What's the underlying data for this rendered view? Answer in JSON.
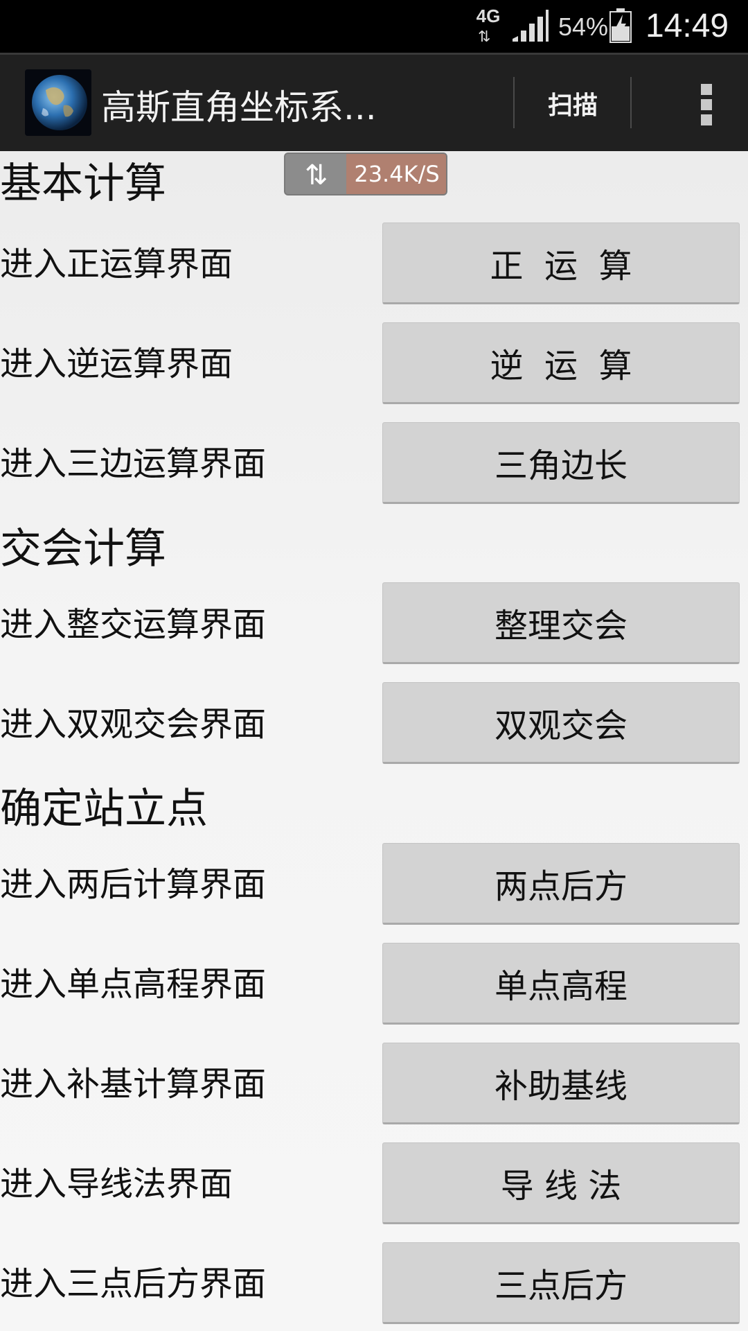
{
  "status_bar": {
    "network": "4G",
    "battery": "54%",
    "time": "14:49"
  },
  "action_bar": {
    "title": "高斯直角坐标系...",
    "scan_label": "扫描",
    "app_icon": "globe-icon",
    "overflow_icon": "overflow-menu-icon"
  },
  "speed_indicator": {
    "icon": "sync-arrows-icon",
    "value": "23.4K/S"
  },
  "sections": [
    {
      "title": "基本计算",
      "rows": [
        {
          "label": "进入正运算界面",
          "button": "正  运  算"
        },
        {
          "label": "进入逆运算界面",
          "button": "逆  运  算"
        },
        {
          "label": "进入三边运算界面",
          "button": "三角边长"
        }
      ]
    },
    {
      "title": "交会计算",
      "rows": [
        {
          "label": "进入整交运算界面",
          "button": "整理交会"
        },
        {
          "label": "进入双观交会界面",
          "button": "双观交会"
        }
      ]
    },
    {
      "title": "确定站立点",
      "rows": [
        {
          "label": "进入两后计算界面",
          "button": "两点后方"
        },
        {
          "label": "进入单点高程界面",
          "button": "单点高程"
        },
        {
          "label": "进入补基计算界面",
          "button": "补助基线"
        },
        {
          "label": "进入导线法界面",
          "button": "导 线 法"
        },
        {
          "label": "进入三点后方界面",
          "button": "三点后方"
        }
      ]
    }
  ]
}
